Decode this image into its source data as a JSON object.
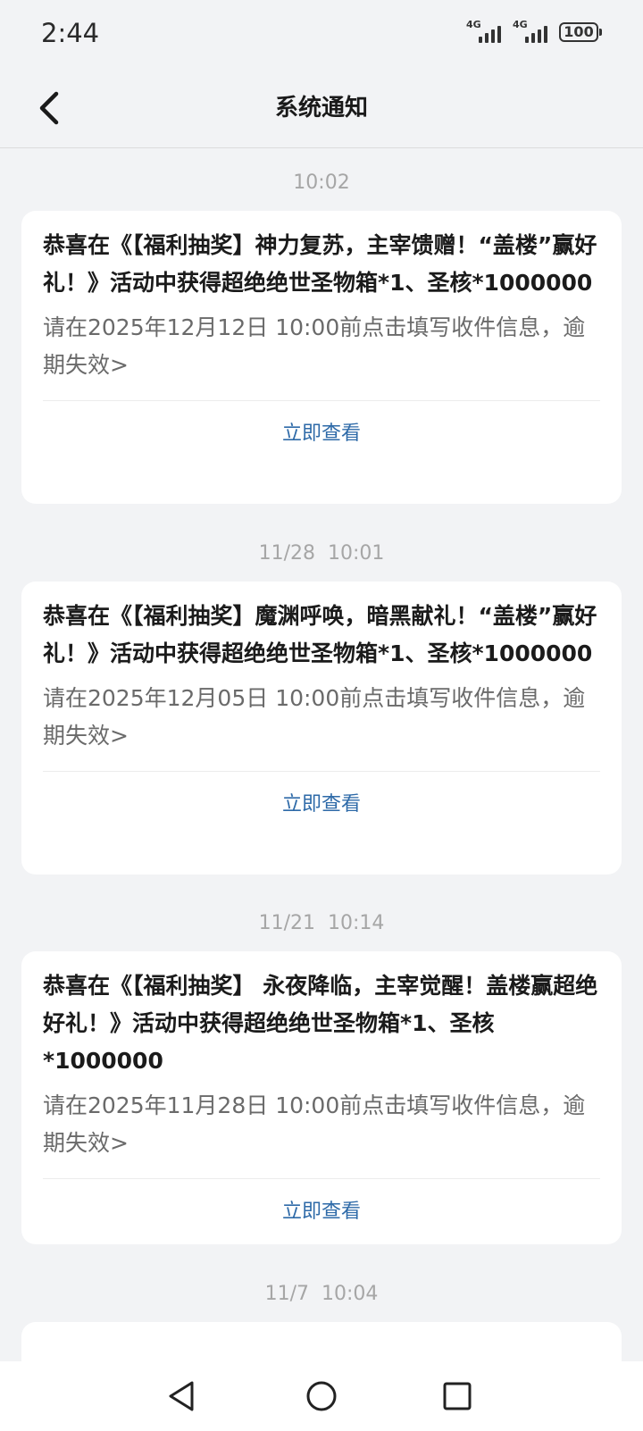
{
  "status": {
    "time": "2:44",
    "network_1": "4G",
    "network_2": "4G",
    "battery": "100"
  },
  "header": {
    "title": "系统通知",
    "back_icon": "chevron-left-icon"
  },
  "notifications": [
    {
      "time": "10:02",
      "title": "恭喜在《【福利抽奖】神力复苏，主宰馈赠！“盖楼”赢好礼！》活动中获得超绝绝世圣物箱*1、圣核*1000000",
      "desc": "请在2025年12月12日 10:00前点击填写收件信息，逾期失效>",
      "action": "立即查看"
    },
    {
      "time": "11/28  10:01",
      "title": "恭喜在《【福利抽奖】魔渊呼唤，暗黑献礼！“盖楼”赢好礼！》活动中获得超绝绝世圣物箱*1、圣核*1000000",
      "desc": "请在2025年12月05日 10:00前点击填写收件信息，逾期失效>",
      "action": "立即查看"
    },
    {
      "time": "11/21  10:14",
      "title": "恭喜在《【福利抽奖】 永夜降临，主宰觉醒！盖楼赢超绝好礼！》活动中获得超绝绝世圣物箱*1、圣核*1000000",
      "desc": "请在2025年11月28日 10:00前点击填写收件信息，逾期失效>",
      "action": "立即查看"
    },
    {
      "time": "11/7  10:04"
    }
  ],
  "system_nav": {
    "back_icon": "triangle-back-icon",
    "home_icon": "circle-home-icon",
    "recents_icon": "square-recents-icon"
  }
}
